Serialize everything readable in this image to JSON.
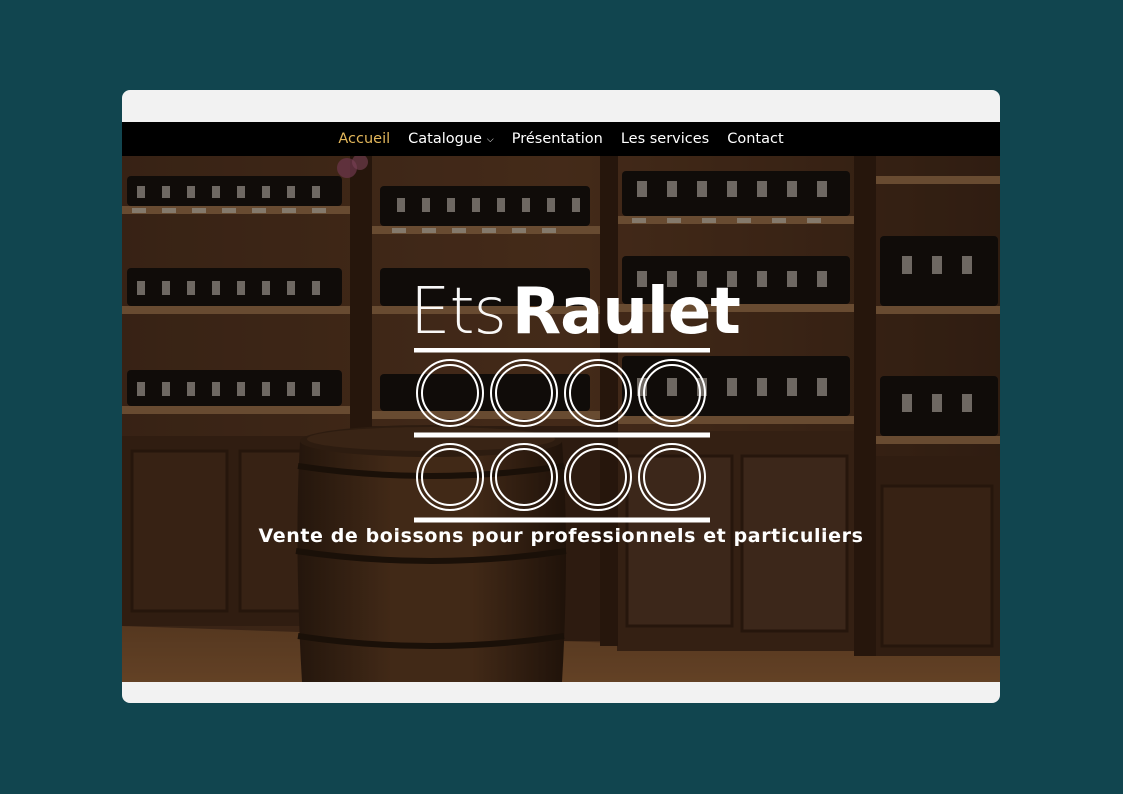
{
  "nav": {
    "items": [
      {
        "label": "Accueil",
        "active": true,
        "has_dropdown": false
      },
      {
        "label": "Catalogue",
        "active": false,
        "has_dropdown": true
      },
      {
        "label": "Présentation",
        "active": false,
        "has_dropdown": false
      },
      {
        "label": "Les services",
        "active": false,
        "has_dropdown": false
      },
      {
        "label": "Contact",
        "active": false,
        "has_dropdown": false
      }
    ],
    "dropdown_icon": "chevron-down-icon"
  },
  "hero": {
    "logo_light": "Ets",
    "logo_bold": "Raulet",
    "logo_symbol": "eight-rings-barrel-icon",
    "tagline": "Vente de boissons pour professionnels et particuliers",
    "background": "wine-cellar-photo"
  },
  "colors": {
    "page_background": "#11454f",
    "nav_background": "#000000",
    "nav_active": "#e3b75b",
    "nav_text": "#ffffff",
    "frame": "#f2f2f2"
  }
}
